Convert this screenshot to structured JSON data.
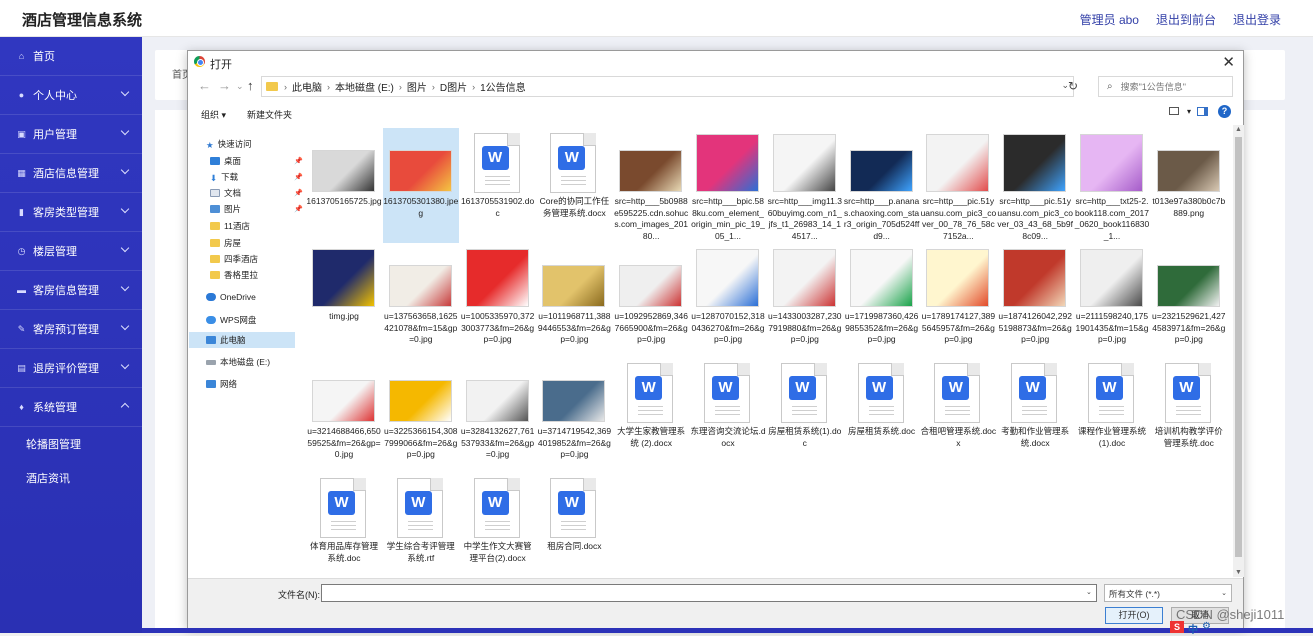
{
  "app": {
    "title": "酒店管理信息系统",
    "admin": "管理员 abo",
    "to_front": "退出到前台",
    "logout": "退出登录"
  },
  "sidebar": {
    "items": [
      {
        "label": "首页",
        "icon": "home-icon",
        "chevron": false
      },
      {
        "label": "个人中心",
        "icon": "user-icon",
        "chevron": true
      },
      {
        "label": "用户管理",
        "icon": "users-icon",
        "chevron": true
      },
      {
        "label": "酒店信息管理",
        "icon": "hotel-icon",
        "chevron": true
      },
      {
        "label": "客房类型管理",
        "icon": "chart-icon",
        "chevron": true
      },
      {
        "label": "楼层管理",
        "icon": "clock-icon",
        "chevron": true
      },
      {
        "label": "客房信息管理",
        "icon": "bed-icon",
        "chevron": true
      },
      {
        "label": "客房预订管理",
        "icon": "booking-icon",
        "chevron": true
      },
      {
        "label": "退房评价管理",
        "icon": "grid-icon",
        "chevron": true
      },
      {
        "label": "系统管理",
        "icon": "mic-icon",
        "chevron": true,
        "expanded": true
      }
    ],
    "subitems": [
      "轮播图管理",
      "酒店资讯"
    ]
  },
  "main": {
    "breadcrumb": "首页"
  },
  "dialog": {
    "title": "打开",
    "path": [
      "此电脑",
      "本地磁盘 (E:)",
      "图片",
      "D图片",
      "1公告信息"
    ],
    "search_placeholder": "搜索\"1公告信息\"",
    "organize": "组织 ▾",
    "new_folder": "新建文件夹",
    "nav": {
      "quick_access": "快速访问",
      "desktop": "桌面",
      "downloads": "下载",
      "documents": "文档",
      "pictures": "图片",
      "f1": "11酒店",
      "f2": "房屋",
      "f3": "四季酒店",
      "f4": "香格里拉",
      "onedrive": "OneDrive",
      "wps": "WPS网盘",
      "this_pc": "此电脑",
      "local_disk": "本地磁盘 (E:)",
      "network": "网络"
    },
    "files": [
      {
        "name": "1613705165725.jpg",
        "kind": "img"
      },
      {
        "name": "1613705301380.jpeg",
        "kind": "img",
        "selected": true
      },
      {
        "name": "1613705531902.doc",
        "kind": "doc"
      },
      {
        "name": "Core的协同工作任务管理系统.docx",
        "kind": "doc"
      },
      {
        "name": "src=http___5b0988e595225.cdn.sohucs.com_images_20180...",
        "kind": "img"
      },
      {
        "name": "src=http___bpic.588ku.com_element_origin_min_pic_19_05_1...",
        "kind": "img"
      },
      {
        "name": "src=http___img11.360buyimg.com_n1_jfs_t1_26983_14_14517...",
        "kind": "img"
      },
      {
        "name": "src=http___p.ananas.chaoxing.com_star3_origin_705d524ffd9...",
        "kind": "img"
      },
      {
        "name": "src=http___pic.51yuansu.com_pic3_cover_00_78_76_58c7152a...",
        "kind": "img"
      },
      {
        "name": "src=http___pic.51yuansu.com_pic3_cover_03_43_68_5b9f8c09...",
        "kind": "img"
      },
      {
        "name": "src=http___txt25-2.book118.com_2017_0620_book116830_1...",
        "kind": "img"
      },
      {
        "name": "t013e97a380b0c7b889.png",
        "kind": "img"
      },
      {
        "name": "timg.jpg",
        "kind": "img"
      },
      {
        "name": "u=137563658,1625421078&fm=15&gp=0.jpg",
        "kind": "img"
      },
      {
        "name": "u=1005335970,3723003773&fm=26&gp=0.jpg",
        "kind": "img"
      },
      {
        "name": "u=1011968711,3889446553&fm=26&gp=0.jpg",
        "kind": "img"
      },
      {
        "name": "u=1092952869,3467665900&fm=26&gp=0.jpg",
        "kind": "img"
      },
      {
        "name": "u=1287070152,3180436270&fm=26&gp=0.jpg",
        "kind": "img"
      },
      {
        "name": "u=1433003287,2307919880&fm=26&gp=0.jpg",
        "kind": "img"
      },
      {
        "name": "u=1719987360,4269855352&fm=26&gp=0.jpg",
        "kind": "img"
      },
      {
        "name": "u=1789174127,3895645957&fm=26&gp=0.jpg",
        "kind": "img"
      },
      {
        "name": "u=1874126042,2925198873&fm=26&gp=0.jpg",
        "kind": "img"
      },
      {
        "name": "u=2111598240,1751901435&fm=15&gp=0.jpg",
        "kind": "img"
      },
      {
        "name": "u=2321529621,4274583971&fm=26&gp=0.jpg",
        "kind": "img"
      },
      {
        "name": "u=3214688466,65059525&fm=26&gp=0.jpg",
        "kind": "img"
      },
      {
        "name": "u=3225366154,3087999066&fm=26&gp=0.jpg",
        "kind": "img"
      },
      {
        "name": "u=3284132627,761537933&fm=26&gp=0.jpg",
        "kind": "img"
      },
      {
        "name": "u=3714719542,3694019852&fm=26&gp=0.jpg",
        "kind": "img"
      },
      {
        "name": "大学生家教管理系统 (2).docx",
        "kind": "doc"
      },
      {
        "name": "东理咨询交流论坛.docx",
        "kind": "doc"
      },
      {
        "name": "房屋租赁系统(1).doc",
        "kind": "doc"
      },
      {
        "name": "房屋租赁系统.doc",
        "kind": "doc"
      },
      {
        "name": "合租吧管理系统.docx",
        "kind": "doc"
      },
      {
        "name": "考勤和作业管理系统.docx",
        "kind": "doc"
      },
      {
        "name": "课程作业管理系统 (1).doc",
        "kind": "doc"
      },
      {
        "name": "培训机构教学评价管理系统.doc",
        "kind": "doc"
      },
      {
        "name": "体育用品库存管理系统.doc",
        "kind": "doc"
      },
      {
        "name": "学生综合考评管理系统.rtf",
        "kind": "doc"
      },
      {
        "name": "中学生作文大赛管理平台(2).docx",
        "kind": "doc"
      },
      {
        "name": "租房合同.docx",
        "kind": "doc"
      }
    ],
    "filename_label": "文件名(N):",
    "filename_value": "",
    "filetype": "所有文件 (*.*)",
    "open": "打开(O)",
    "cancel": "取消"
  },
  "watermark": "CSDN @sheji1011",
  "ime": "中"
}
